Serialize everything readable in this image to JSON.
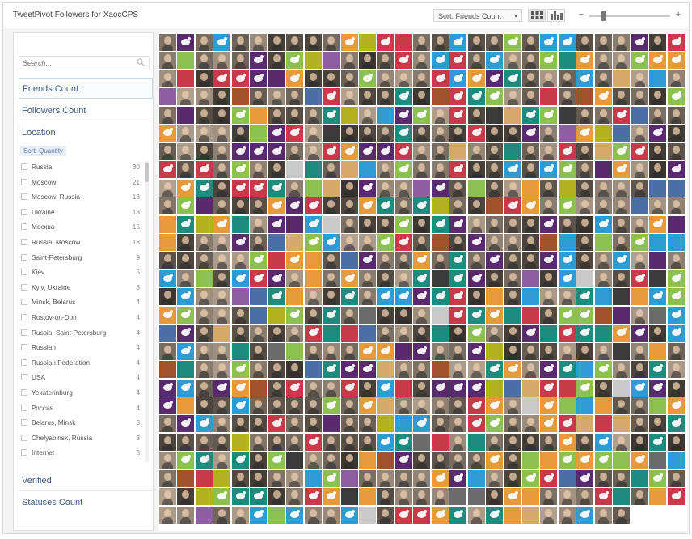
{
  "app": {
    "title": "TweetPivot Followers for XaocCPS"
  },
  "header": {
    "sort_label": "Sort: Friends Count",
    "grid_view_icon": "grid-view-icon",
    "histogram_view_icon": "histogram-view-icon",
    "zoom_minus": "−",
    "zoom_plus": "+",
    "zoom_level": 0.17
  },
  "sidebar": {
    "search_placeholder": "Search...",
    "facets": {
      "friends_count": "Friends Count",
      "followers_count": "Followers Count",
      "location": "Location",
      "verified": "Verified",
      "statuses_count": "Statuses Count"
    },
    "location_sort": "Sort: Quantity",
    "locations": [
      {
        "label": "Russia",
        "count": "30"
      },
      {
        "label": "Moscow",
        "count": "21"
      },
      {
        "label": "Moscow, Russia",
        "count": "18"
      },
      {
        "label": "Ukraine",
        "count": "18"
      },
      {
        "label": "Москва",
        "count": "15"
      },
      {
        "label": "Russia, Moscow",
        "count": "13"
      },
      {
        "label": "Saint-Petersburg",
        "count": "9"
      },
      {
        "label": "Kiev",
        "count": "5"
      },
      {
        "label": "Kyiv, Ukraine",
        "count": "5"
      },
      {
        "label": "Minsk, Belarus",
        "count": "4"
      },
      {
        "label": "Rostov-on-Don",
        "count": "4"
      },
      {
        "label": "Russia, Saint-Petersburg",
        "count": "4"
      },
      {
        "label": "Russian",
        "count": "4"
      },
      {
        "label": "Russian Federation",
        "count": "4"
      },
      {
        "label": "USA",
        "count": "4"
      },
      {
        "label": "Yekaterinburg",
        "count": "4"
      },
      {
        "label": "Россия",
        "count": "4"
      },
      {
        "label": "Belarus, Minsk",
        "count": "3"
      },
      {
        "label": "Chelyabinsk, Russia",
        "count": "3"
      },
      {
        "label": "Internet",
        "count": "3"
      }
    ]
  },
  "grid": {
    "columns": 29,
    "rows": 27,
    "last_row_count": 26,
    "palette": [
      "#e79a3c",
      "#5a2a6e",
      "#c83a4a",
      "#1d8b7e",
      "#8cc152",
      "#2f9bd3",
      "#6b6b6b",
      "#a0522d",
      "#3b3b3b",
      "#d4a96a",
      "#4a6fa5",
      "#c9c9c9",
      "#8e5ea2",
      "#b2b21e"
    ]
  }
}
